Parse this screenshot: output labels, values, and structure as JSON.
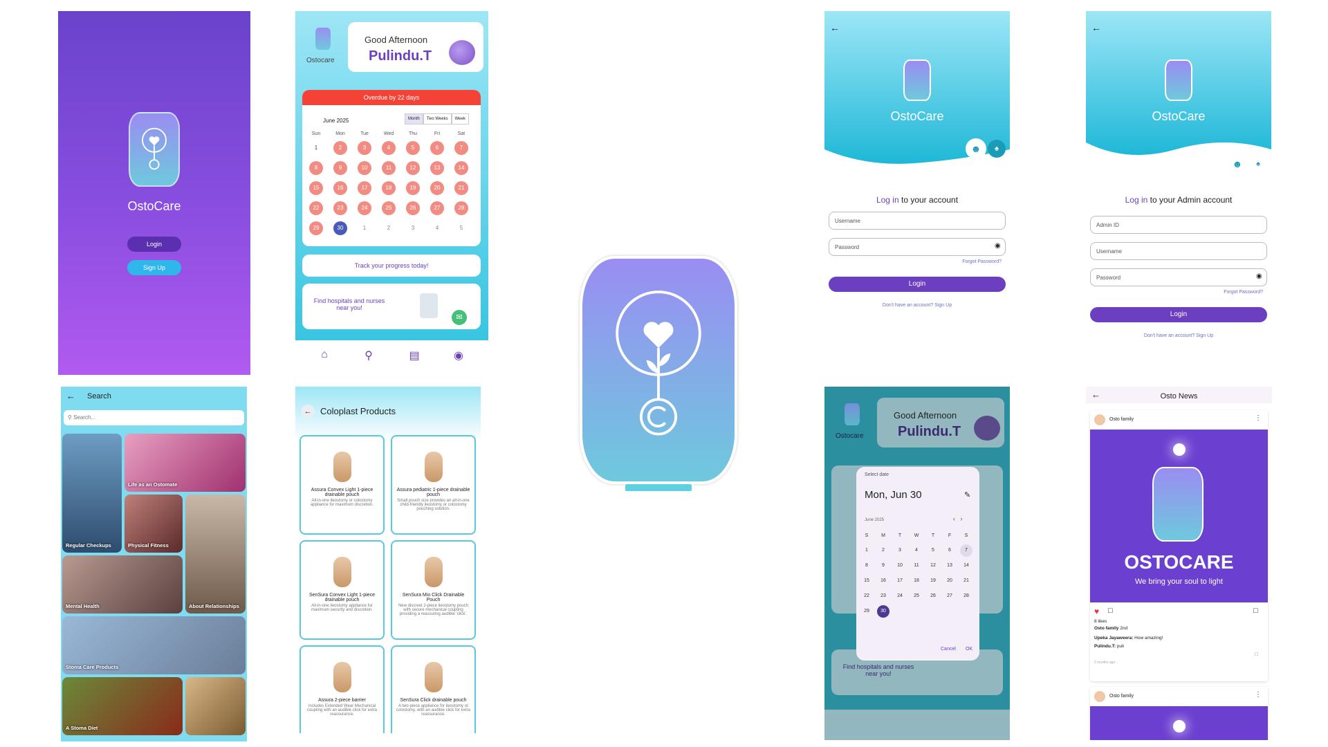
{
  "splash": {
    "app_name": "OstoCare",
    "login": "Login",
    "signup": "Sign Up"
  },
  "dashboard": {
    "logo_label": "Ostocare",
    "greeting": "Good Afternoon",
    "user": "Pulindu.T",
    "overdue": "Overdue by 22 days",
    "month": "June 2025",
    "views": [
      "Month",
      "Two Weeks",
      "Week"
    ],
    "weekdays": [
      "Sun",
      "Mon",
      "Tue",
      "Wed",
      "Thu",
      "Fri",
      "Sat"
    ],
    "days": [
      [
        "1",
        "2",
        "3",
        "4",
        "5",
        "6",
        "7"
      ],
      [
        "8",
        "9",
        "10",
        "11",
        "12",
        "13",
        "14"
      ],
      [
        "15",
        "16",
        "17",
        "18",
        "19",
        "20",
        "21"
      ],
      [
        "22",
        "23",
        "24",
        "25",
        "26",
        "27",
        "28"
      ],
      [
        "29",
        "30",
        "1",
        "2",
        "3",
        "4",
        "5"
      ]
    ],
    "track": "Track your progress today!",
    "hospitals": "Find hospitals and nurses near you!"
  },
  "login_user": {
    "app_name": "OstoCare",
    "title_prefix": "Log in",
    "title_rest": " to your account",
    "username": "Username",
    "password": "Password",
    "forgot": "Forgot Password?",
    "login": "Login",
    "signup": "Don't have an account? Sign Up"
  },
  "login_admin": {
    "app_name": "OstoCare",
    "title_prefix": "Log in",
    "title_rest": " to your Admin account",
    "admin_id": "Admin ID",
    "username": "Username",
    "password": "Password",
    "forgot": "Forgot Password?",
    "login": "Login",
    "signup": "Don't have an account? Sign Up"
  },
  "search": {
    "title": "Search",
    "placeholder": "Search...",
    "tiles": [
      "Regular Checkups",
      "Life as an Ostomate",
      "Physical Fitness",
      "About Relationships",
      "Mental Health",
      "Stoma Care Products",
      "A Stoma Diet"
    ]
  },
  "products": {
    "title": "Coloplast Products",
    "items": [
      {
        "name": "Assura Convex Light 1-piece drainable pouch",
        "desc": "All-in-one ileostomy or colostomy appliance for maximum discretion."
      },
      {
        "name": "Assura pediatric 1-piece drainable pouch",
        "desc": "Small pouch size provides an all-in-one child-friendly ileostomy or colostomy pouching solution."
      },
      {
        "name": "SenSura Convex Light 1-piece drainable pouch",
        "desc": "All-in-one ileostomy appliance for maximum security and discretion."
      },
      {
        "name": "SenSura Mio Click Drainable Pouch",
        "desc": "New discreet 2-piece ileostomy pouch with secure mechanical coupling providing a reassuring audible 'click'."
      },
      {
        "name": "Assura 2-piece barrier",
        "desc": "Includes Extended Wear Mechanical coupling with an audible click for extra reassurance."
      },
      {
        "name": "SenSura Click drainable pouch",
        "desc": "A two-piece appliance for ileostomy or colostomy, with an audible click for extra reassurance."
      }
    ]
  },
  "datepicker": {
    "logo_label": "Ostocare",
    "greeting": "Good Afternoon",
    "user": "Pulindu.T",
    "label": "Select date",
    "date": "Mon, Jun 30",
    "month": "June 2025",
    "weekdays": [
      "S",
      "M",
      "T",
      "W",
      "T",
      "F",
      "S"
    ],
    "days": [
      [
        "1",
        "2",
        "3",
        "4",
        "5",
        "6",
        "7"
      ],
      [
        "8",
        "9",
        "10",
        "11",
        "12",
        "13",
        "14"
      ],
      [
        "15",
        "16",
        "17",
        "18",
        "19",
        "20",
        "21"
      ],
      [
        "22",
        "23",
        "24",
        "25",
        "26",
        "27",
        "28"
      ],
      [
        "29",
        "30",
        "",
        "",
        "",
        "",
        ""
      ]
    ],
    "cancel": "Cancel",
    "ok": "OK",
    "hospitals": "Find hospitals and nurses near you!"
  },
  "news": {
    "title": "Osto News",
    "author": "Osto family",
    "brand": "OSTOCARE",
    "tagline": "We bring your soul to light",
    "likes": "8 likes",
    "caption_author": "Osto family",
    "caption_time": "2nd",
    "c1_user": "Upeka Jayaweera:",
    "c1_text": " How amazing!",
    "c2_user": "Pulindu.T:",
    "c2_text": " puli",
    "time": "2 months ago",
    "author2": "Osto family"
  },
  "colors": {
    "primary": "#6b3fc0",
    "accent": "#2fc2df",
    "overdue": "#f44336",
    "pink": "#f28b82"
  }
}
